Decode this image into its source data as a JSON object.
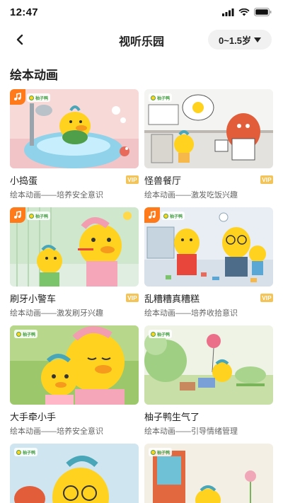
{
  "status_bar": {
    "time": "12:47"
  },
  "nav": {
    "title": "视听乐园",
    "age_range": "0~1.5岁"
  },
  "section": {
    "title": "绘本动画"
  },
  "brand_mark": "柚子鸭",
  "vip_label": "VIP",
  "cards": [
    {
      "title": "小捣蛋",
      "subtitle": "绘本动画——培养安全意识",
      "vip": true,
      "music": true,
      "scene": "bath"
    },
    {
      "title": "怪兽餐厅",
      "subtitle": "绘本动画——激发吃饭兴趣",
      "vip": true,
      "music": false,
      "scene": "kitchen"
    },
    {
      "title": "刷牙小警车",
      "subtitle": "绘本动画——激发刷牙兴趣",
      "vip": true,
      "music": true,
      "scene": "toothbrush"
    },
    {
      "title": "乱糟糟真糟糕",
      "subtitle": "绘本动画——培养收拾意识",
      "vip": true,
      "music": true,
      "scene": "messy-room"
    },
    {
      "title": "大手牵小手",
      "subtitle": "绘本动画——培养安全意识",
      "vip": false,
      "music": false,
      "scene": "hug"
    },
    {
      "title": "柚子鸭生气了",
      "subtitle": "绘本动画——引导情绪管理",
      "vip": false,
      "music": false,
      "scene": "garden"
    },
    {
      "title": "",
      "subtitle": "",
      "vip": false,
      "music": false,
      "scene": "portrait"
    },
    {
      "title": "",
      "subtitle": "",
      "vip": false,
      "music": false,
      "scene": "door"
    }
  ],
  "colors": {
    "music_badge": "#ff7a1a",
    "vip_badge": "#f2c45a",
    "duck_yellow": "#ffd21f"
  }
}
